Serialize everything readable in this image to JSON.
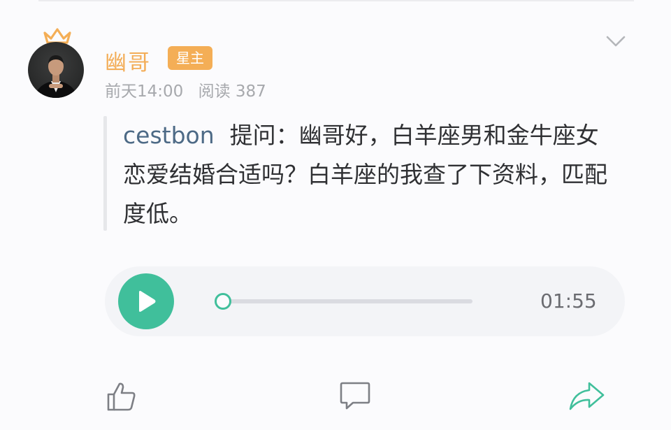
{
  "post": {
    "author_name": "幽哥",
    "role_badge": "星主",
    "time": "前天14:00",
    "views": "阅读 387",
    "question": {
      "asker": "cestbon",
      "text": "提问：幽哥好，白羊座男和金牛座女恋爱结婚合适吗？白羊座的我查了下资料，匹配度低。"
    },
    "audio": {
      "duration": "01:55",
      "progress": 0
    }
  },
  "icons": {
    "crown": "crown-icon",
    "menu": "chevron-down-icon",
    "play": "play-icon",
    "like": "thumbs-up-icon",
    "comment": "comment-icon",
    "share": "share-icon"
  },
  "colors": {
    "accent_orange": "#f3ad57",
    "accent_green": "#40bf9b",
    "asker_blue": "#4d6a86"
  }
}
